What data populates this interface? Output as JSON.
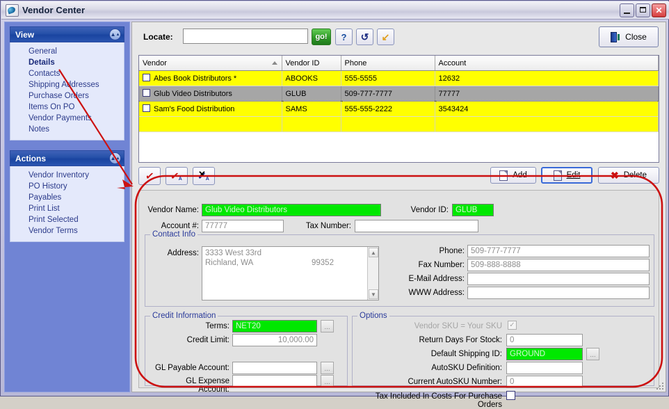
{
  "window": {
    "title": "Vendor Center",
    "icon": "app-logo-icon",
    "minimize": "–",
    "maximize": "□",
    "close": "✕"
  },
  "sidebar": {
    "panels": [
      {
        "title": "View",
        "collapse_icon": "chevron-up-icon",
        "items": [
          {
            "label": "General",
            "active": false
          },
          {
            "label": "Details",
            "active": true
          },
          {
            "label": "Contacts",
            "active": false
          },
          {
            "label": "Shipping Addresses",
            "active": false
          },
          {
            "label": "Purchase Orders",
            "active": false
          },
          {
            "label": "Items On PO",
            "active": false
          },
          {
            "label": "Vendor Payments",
            "active": false
          },
          {
            "label": "Notes",
            "active": false
          }
        ]
      },
      {
        "title": "Actions",
        "collapse_icon": "chevron-up-icon",
        "items": [
          {
            "label": "Vendor Inventory",
            "active": false
          },
          {
            "label": "PO History",
            "active": false
          },
          {
            "label": "Payables",
            "active": false
          },
          {
            "label": "Print List",
            "active": false
          },
          {
            "label": "Print Selected",
            "active": false
          },
          {
            "label": "Vendor Terms",
            "active": false
          }
        ]
      }
    ]
  },
  "toolbar": {
    "locate_label": "Locate:",
    "locate_value": "",
    "locate_placeholder": "",
    "go_label": "go!",
    "help_label": "?",
    "refresh_label": "↺",
    "export_label": "↙",
    "close_label": "Close"
  },
  "grid": {
    "columns": [
      "Vendor",
      "Vendor ID",
      "Phone",
      "Account"
    ],
    "sorted_column": 0,
    "rows": [
      {
        "vendor": "Abes Book Distributors *",
        "vendor_id": "ABOOKS",
        "phone": "555-5555",
        "account": "12632",
        "selected": false
      },
      {
        "vendor": "Glub Video Distributors",
        "vendor_id": "GLUB",
        "phone": "509-777-7777",
        "account": "77777",
        "selected": true
      },
      {
        "vendor": "Sam's Food Distribution",
        "vendor_id": "SAMS",
        "phone": "555-555-2222",
        "account": "3543424",
        "selected": false
      }
    ]
  },
  "grid_actions": {
    "check_one": "check-icon",
    "check_all": "check-all-icon",
    "uncheck_all": "uncheck-all-icon",
    "add_label": "Add",
    "edit_label": "Edit",
    "delete_label": "Delete"
  },
  "detail": {
    "vendor_name_label": "Vendor Name:",
    "vendor_name_value": "Glub Video Distributors",
    "vendor_id_label": "Vendor ID:",
    "vendor_id_value": "GLUB",
    "account_label": "Account #:",
    "account_value": "77777",
    "tax_number_label": "Tax Number:",
    "tax_number_value": "",
    "contact_info": {
      "title": "Contact Info",
      "address_label": "Address:",
      "address_line1": "3333 West 33rd",
      "address_city_state": "Richland, WA",
      "address_zip": "99352",
      "phone_label": "Phone:",
      "phone_value": "509-777-7777",
      "fax_label": "Fax Number:",
      "fax_value": "509-888-8888",
      "email_label": "E-Mail Address:",
      "email_value": "",
      "www_label": "WWW Address:",
      "www_value": ""
    },
    "credit_info": {
      "title": "Credit Information",
      "terms_label": "Terms:",
      "terms_value": "NET20",
      "credit_limit_label": "Credit Limit:",
      "credit_limit_value": "10,000.00",
      "gl_payable_label": "GL Payable Account:",
      "gl_payable_value": "",
      "gl_expense_label": "GL Expense Account:",
      "gl_expense_value": "",
      "ellipsis": "..."
    },
    "options": {
      "title": "Options",
      "vendor_sku_label": "Vendor SKU = Your SKU",
      "vendor_sku_checked": true,
      "return_days_label": "Return Days For Stock:",
      "return_days_value": "0",
      "default_shipping_label": "Default Shipping ID:",
      "default_shipping_value": "GROUND",
      "autosku_def_label": "AutoSKU Definition:",
      "autosku_def_value": "",
      "current_autosku_label": "Current AutoSKU Number:",
      "current_autosku_value": "0",
      "tax_included_label": "Tax Included In Costs For Purchase Orders",
      "tax_included_checked": false,
      "ellipsis": "..."
    }
  },
  "annotation": {
    "color": "#cc1111",
    "shape": "rounded-rectangle-highlight",
    "arrow_from": "Details",
    "arrow_to": "detail-panel"
  }
}
